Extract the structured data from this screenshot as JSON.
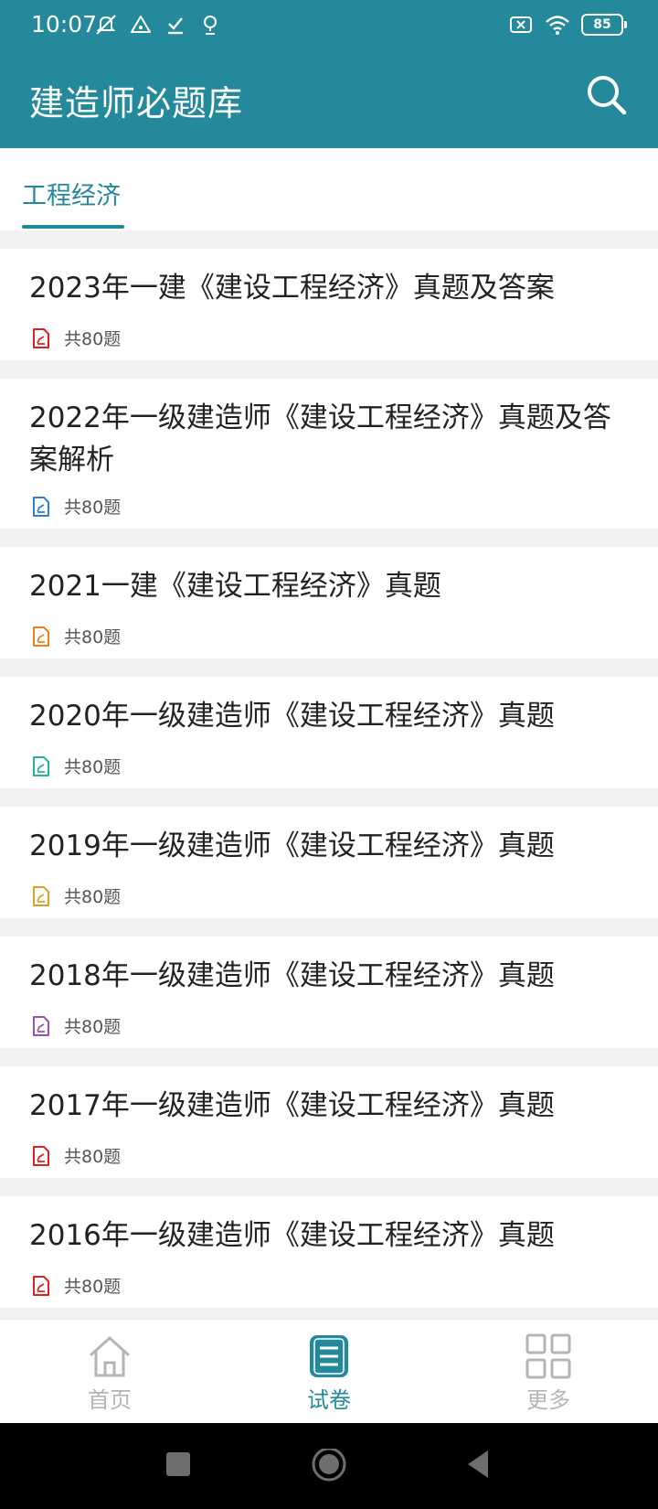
{
  "status": {
    "time": "10:07",
    "battery": "85"
  },
  "app": {
    "title": "建造师必题库"
  },
  "tabs": {
    "active": "工程经济"
  },
  "papers": [
    {
      "title": "2023年一建《建设工程经济》真题及答案",
      "count": "共80题",
      "icon_color": "#e02020"
    },
    {
      "title": "2022年一级建造师《建设工程经济》真题及答案解析",
      "count": "共80题",
      "icon_color": "#2f7fd1"
    },
    {
      "title": "2021一建《建设工程经济》真题",
      "count": "共80题",
      "icon_color": "#e8841a"
    },
    {
      "title": "2020年一级建造师《建设工程经济》真题",
      "count": "共80题",
      "icon_color": "#28b29a"
    },
    {
      "title": "2019年一级建造师《建设工程经济》真题",
      "count": "共80题",
      "icon_color": "#e0a020"
    },
    {
      "title": "2018年一级建造师《建设工程经济》真题",
      "count": "共80题",
      "icon_color": "#9b4fb5"
    },
    {
      "title": "2017年一级建造师《建设工程经济》真题",
      "count": "共80题",
      "icon_color": "#e02020"
    },
    {
      "title": "2016年一级建造师《建设工程经济》真题",
      "count": "共80题",
      "icon_color": "#e02020"
    }
  ],
  "bottom_nav": {
    "home": "首页",
    "papers": "试卷",
    "more": "更多",
    "active_color": "#23899b",
    "inactive_color": "#b5b5b5"
  },
  "colors": {
    "primary": "#23899b"
  }
}
